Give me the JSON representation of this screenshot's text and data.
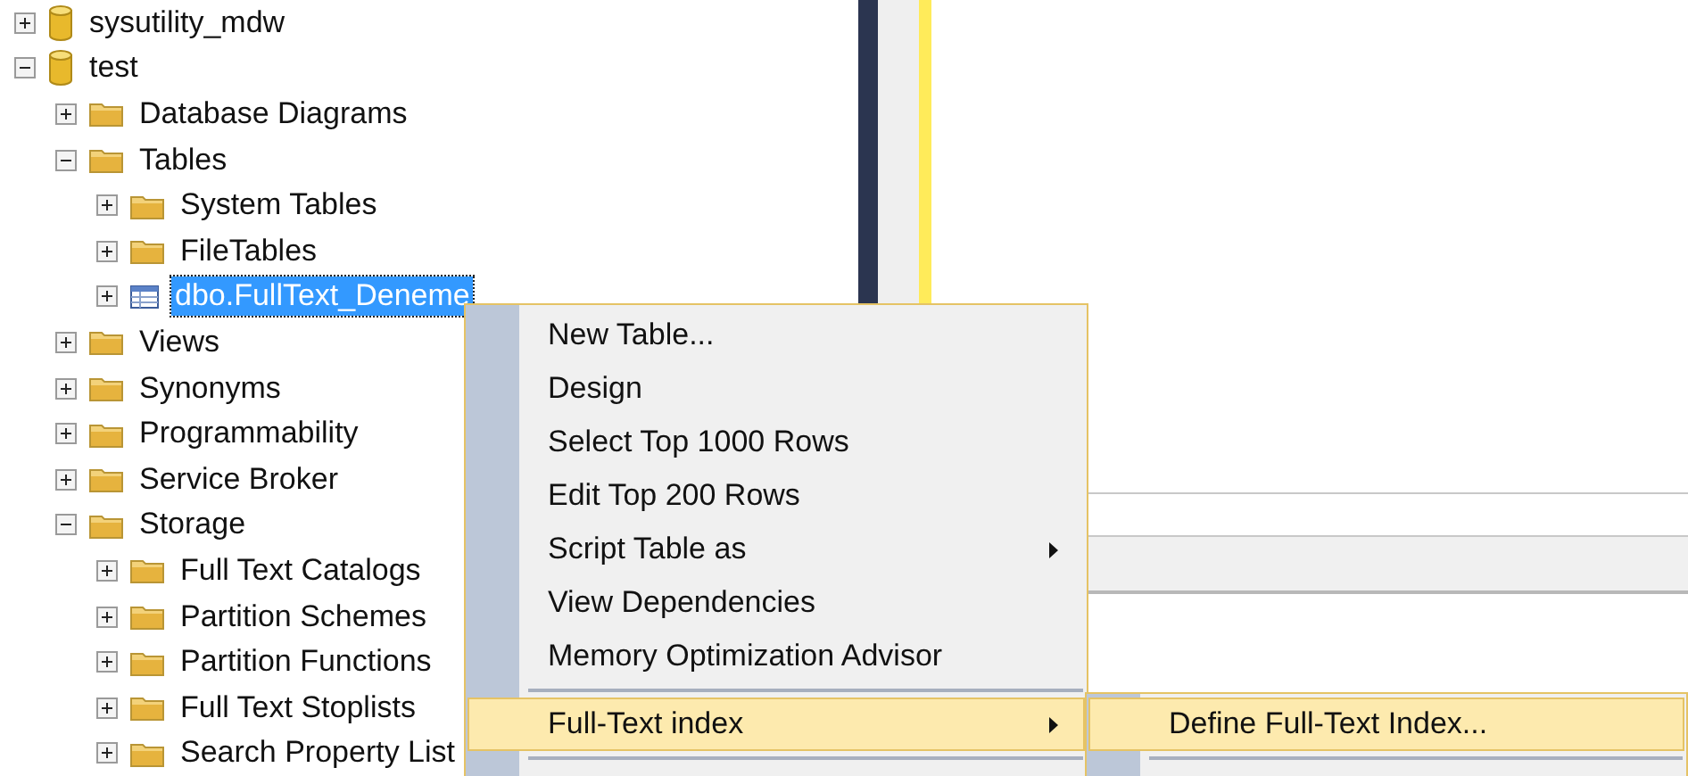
{
  "tree": [
    {
      "label": "sysutility_mdw",
      "kind": "database",
      "expanded": false,
      "selected": false
    },
    {
      "label": "test",
      "kind": "database",
      "expanded": true,
      "selected": false,
      "children": [
        {
          "label": "Database Diagrams",
          "kind": "folder",
          "expanded": false,
          "selected": false
        },
        {
          "label": "Tables",
          "kind": "folder",
          "expanded": true,
          "selected": false,
          "children": [
            {
              "label": "System Tables",
              "kind": "folder",
              "expanded": false,
              "selected": false
            },
            {
              "label": "FileTables",
              "kind": "folder",
              "expanded": false,
              "selected": false
            },
            {
              "label": "dbo.FullText_Deneme",
              "kind": "table",
              "expanded": false,
              "selected": true
            }
          ]
        },
        {
          "label": "Views",
          "kind": "folder",
          "expanded": false,
          "selected": false
        },
        {
          "label": "Synonyms",
          "kind": "folder",
          "expanded": false,
          "selected": false
        },
        {
          "label": "Programmability",
          "kind": "folder",
          "expanded": false,
          "selected": false
        },
        {
          "label": "Service Broker",
          "kind": "folder",
          "expanded": false,
          "selected": false
        },
        {
          "label": "Storage",
          "kind": "folder",
          "expanded": true,
          "selected": false,
          "children": [
            {
              "label": "Full Text Catalogs",
              "kind": "folder",
              "expanded": false,
              "selected": false
            },
            {
              "label": "Partition Schemes",
              "kind": "folder",
              "expanded": false,
              "selected": false
            },
            {
              "label": "Partition Functions",
              "kind": "folder",
              "expanded": false,
              "selected": false
            },
            {
              "label": "Full Text Stoplists",
              "kind": "folder",
              "expanded": false,
              "selected": false
            },
            {
              "label": "Search Property List",
              "kind": "folder",
              "expanded": false,
              "selected": false
            }
          ]
        }
      ]
    }
  ],
  "context_menu": {
    "items": [
      {
        "kind": "item",
        "label": "New Table...",
        "submenu": false,
        "selected": false
      },
      {
        "kind": "item",
        "label": "Design",
        "submenu": false,
        "selected": false
      },
      {
        "kind": "item",
        "label": "Select Top 1000 Rows",
        "submenu": false,
        "selected": false
      },
      {
        "kind": "item",
        "label": "Edit Top 200 Rows",
        "submenu": false,
        "selected": false
      },
      {
        "kind": "item",
        "label": "Script Table as",
        "submenu": true,
        "selected": false
      },
      {
        "kind": "item",
        "label": "View Dependencies",
        "submenu": false,
        "selected": false
      },
      {
        "kind": "item",
        "label": "Memory Optimization Advisor",
        "submenu": false,
        "selected": false
      },
      {
        "kind": "separator"
      },
      {
        "kind": "item",
        "label": "Full-Text index",
        "submenu": true,
        "selected": true
      },
      {
        "kind": "separator"
      }
    ]
  },
  "submenu": {
    "items": [
      {
        "kind": "item",
        "label": "Define Full-Text Index...",
        "submenu": false,
        "selected": true
      },
      {
        "kind": "separator"
      }
    ]
  }
}
